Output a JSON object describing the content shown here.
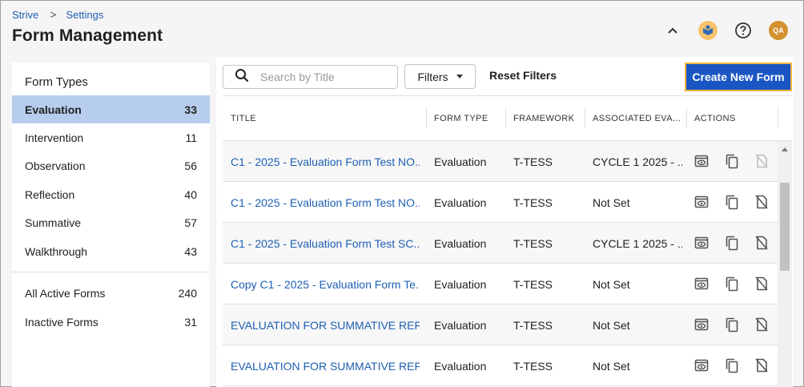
{
  "breadcrumb": {
    "root": "Strive",
    "separator": ">",
    "current": "Settings"
  },
  "page_title": "Form Management",
  "header_icons": {
    "collapse": "chevron-up-icon",
    "org": "book-logo-icon",
    "help": "help-icon",
    "avatar_initials": "QA"
  },
  "sidebar": {
    "title": "Form Types",
    "types": [
      {
        "label": "Evaluation",
        "count": "33",
        "active": true
      },
      {
        "label": "Intervention",
        "count": "11"
      },
      {
        "label": "Observation",
        "count": "56"
      },
      {
        "label": "Reflection",
        "count": "40"
      },
      {
        "label": "Summative",
        "count": "57"
      },
      {
        "label": "Walkthrough",
        "count": "43"
      }
    ],
    "extras": [
      {
        "label": "All Active Forms",
        "count": "240"
      },
      {
        "label": "Inactive Forms",
        "count": "31"
      }
    ]
  },
  "toolbar": {
    "search_placeholder": "Search by Title",
    "filters_label": "Filters",
    "reset_label": "Reset Filters",
    "create_label": "Create New Form"
  },
  "table": {
    "columns": [
      "TITLE",
      "FORM TYPE",
      "FRAMEWORK",
      "ASSOCIATED EVA...",
      "ACTIONS"
    ],
    "rows": [
      {
        "title": "C1 - 2025 - Evaluation Form Test NO...",
        "type": "Evaluation",
        "framework": "T-TESS",
        "associated": "CYCLE 1 2025 - ...",
        "delete_disabled": true
      },
      {
        "title": "C1 - 2025 - Evaluation Form Test NO...",
        "type": "Evaluation",
        "framework": "T-TESS",
        "associated": "Not Set"
      },
      {
        "title": "C1 - 2025 - Evaluation Form Test SC...",
        "type": "Evaluation",
        "framework": "T-TESS",
        "associated": "CYCLE 1 2025 - ..."
      },
      {
        "title": "Copy C1 - 2025 - Evaluation Form Te...",
        "type": "Evaluation",
        "framework": "T-TESS",
        "associated": "Not Set"
      },
      {
        "title": "EVALUATION FOR SUMMATIVE REFI...",
        "type": "Evaluation",
        "framework": "T-TESS",
        "associated": "Not Set"
      },
      {
        "title": "EVALUATION FOR SUMMATIVE REFI...",
        "type": "Evaluation",
        "framework": "T-TESS",
        "associated": "Not Set"
      }
    ]
  },
  "colors": {
    "accent": "#1a56c3",
    "link": "#1e5fb4",
    "active_row": "#b6cdee",
    "focus_border": "#f2b640",
    "avatar": "#d4912f"
  }
}
